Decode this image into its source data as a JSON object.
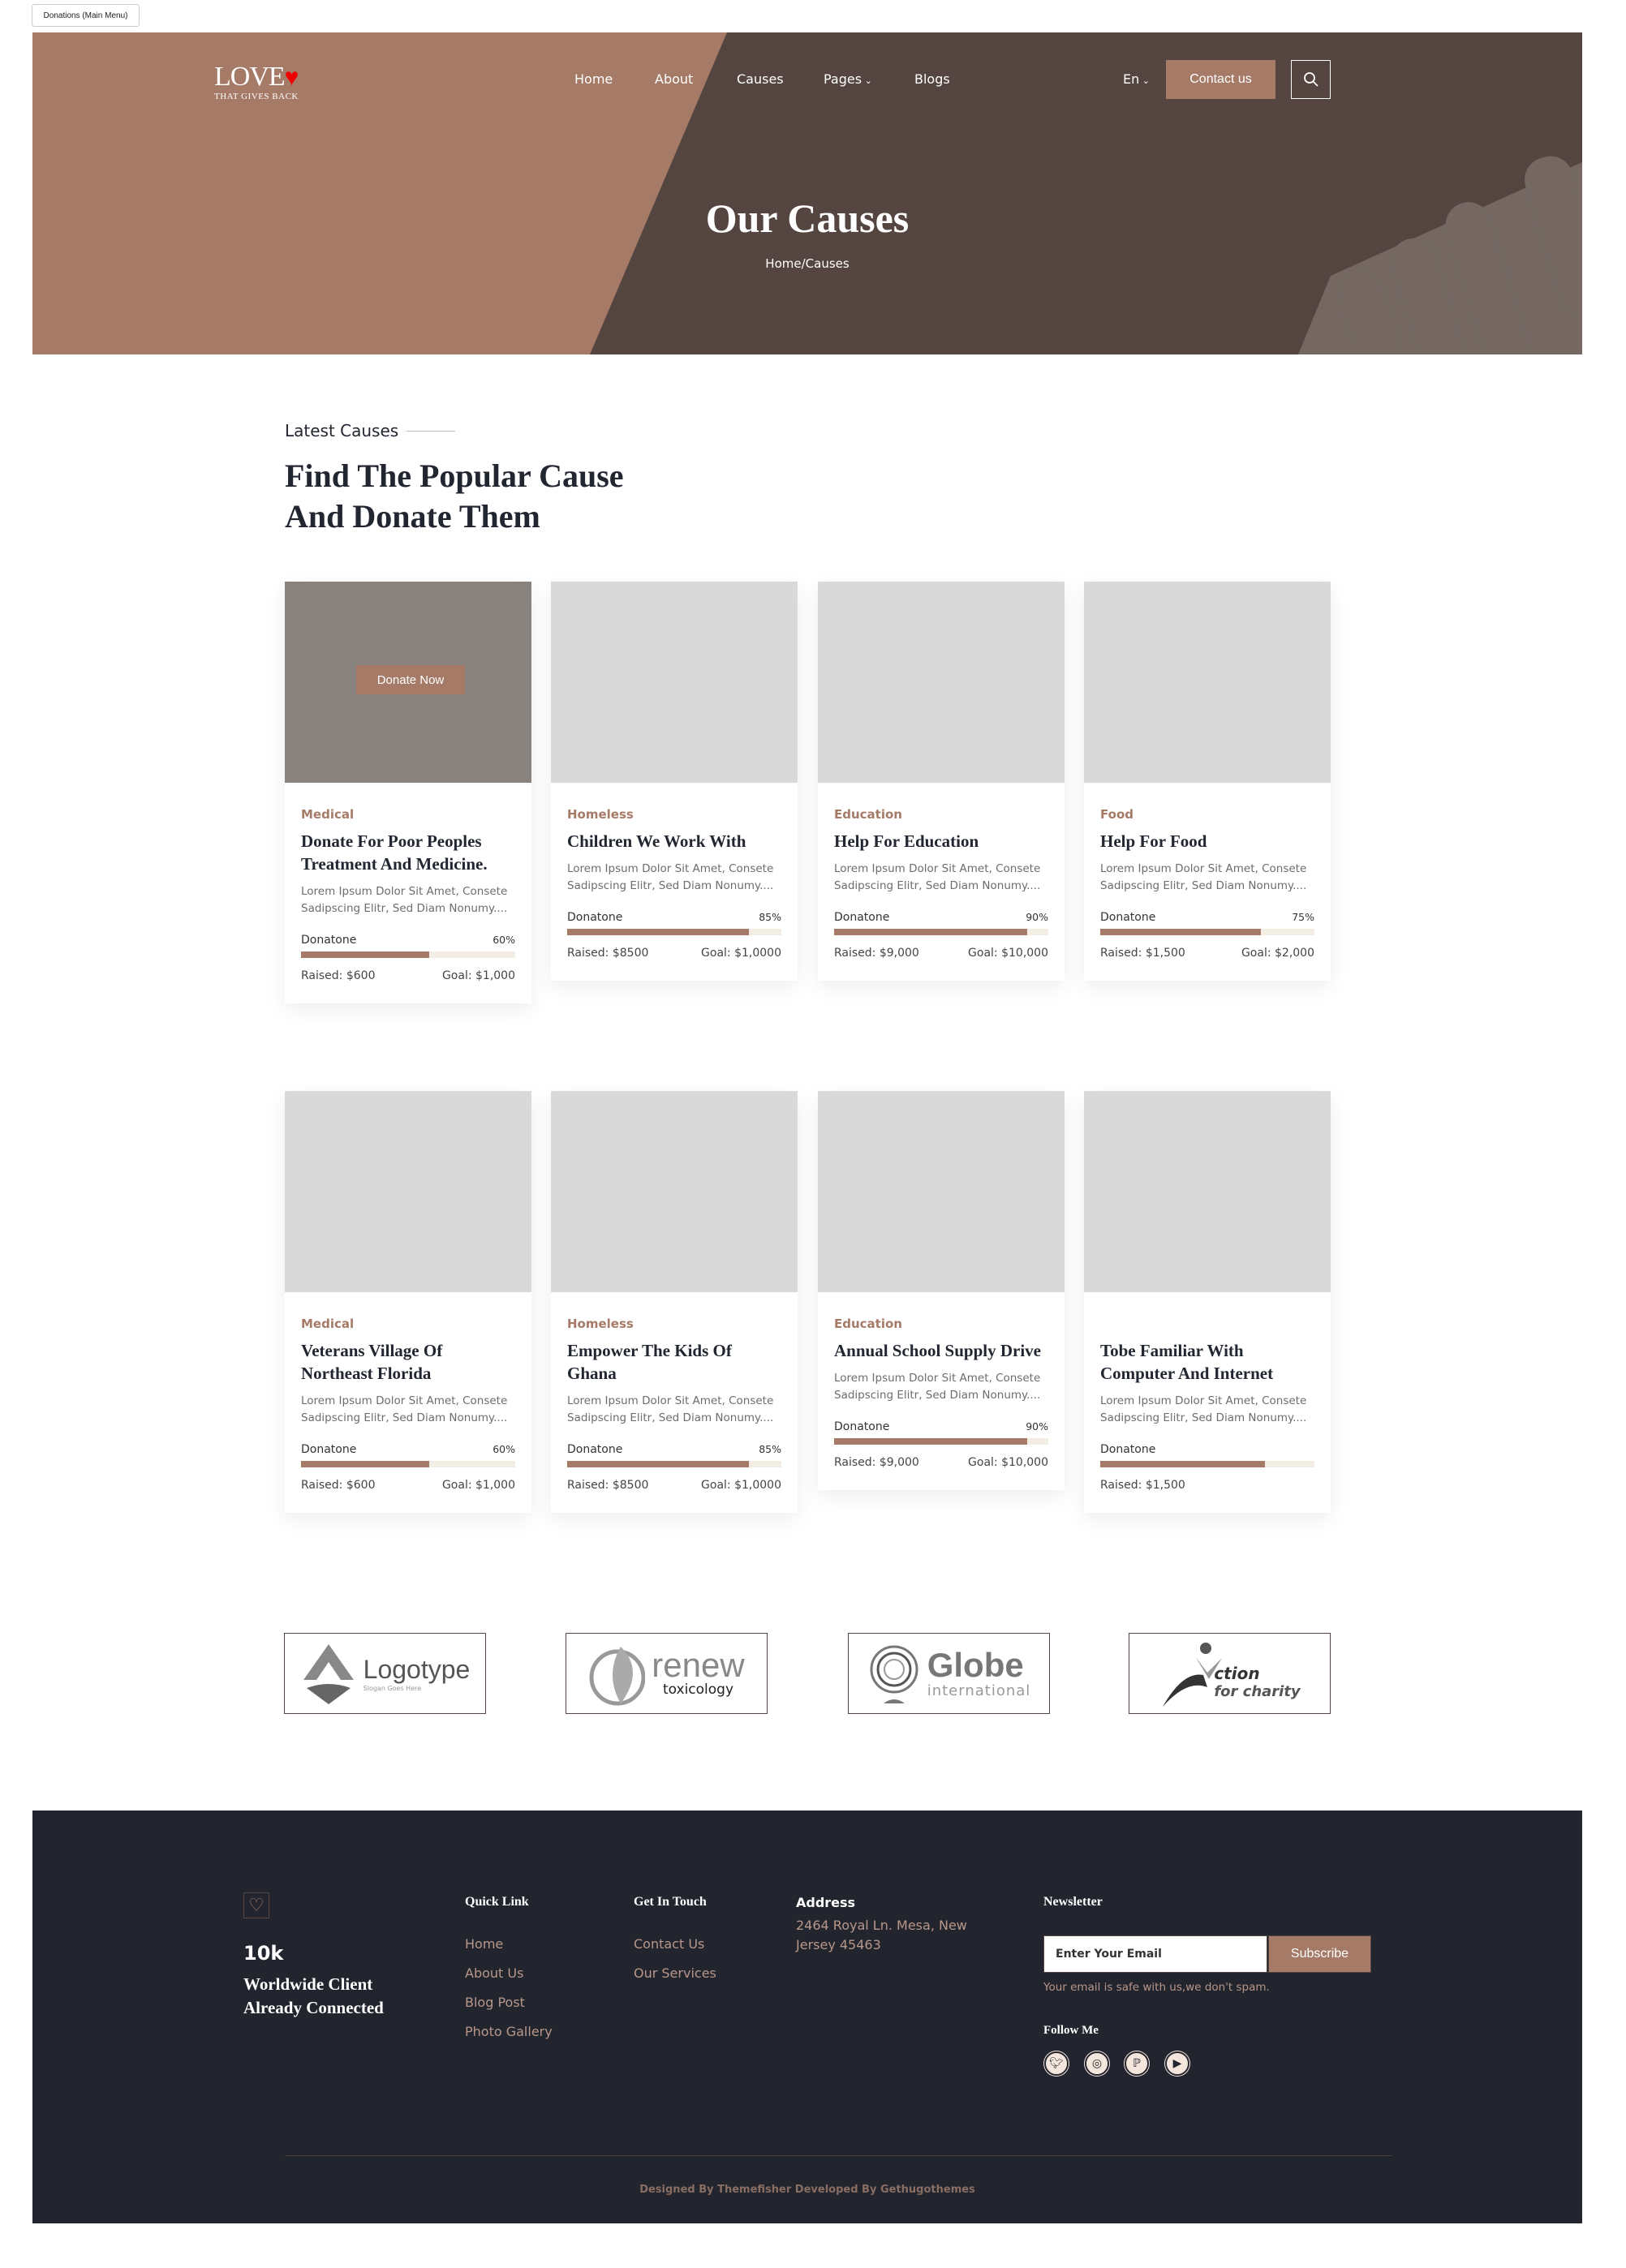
{
  "window_tag": "Donations (Main Menu)",
  "colors": {
    "brand": "#A57A67",
    "hero_dark": "#554540",
    "footer_bg": "#22252E",
    "bar_track": "#F2EEE3"
  },
  "header": {
    "logo_text": "LOVE",
    "logo_tagline": "THAT GIVES BACK",
    "nav": [
      "Home",
      "About",
      "Causes",
      "Pages",
      "Blogs"
    ],
    "language": "En",
    "contact_label": "Contact us",
    "search_icon": "search-icon"
  },
  "hero": {
    "title": "Our Causes",
    "breadcrumb": "Home/Causes"
  },
  "section": {
    "eyebrow": "Latest Causes",
    "heading_line1": "Find The Popular Cause",
    "heading_line2": "And Donate Them"
  },
  "donate_now_label": "Donate Now",
  "progress_label": "Donatone",
  "causes": [
    {
      "category": "Medical",
      "title": "Donate For Poor Peoples Treatment And Medicine.",
      "description": "Lorem Ipsum Dolor Sit Amet, Consete Sadipscing Elitr, Sed Diam Nonumy....",
      "progress": 60,
      "percent_label": "60%",
      "raised": "Raised: $600",
      "goal": "Goal: $1,000"
    },
    {
      "category": "Homeless",
      "title": "Children We Work With",
      "description": "Lorem Ipsum Dolor Sit Amet, Consete Sadipscing Elitr, Sed Diam Nonumy....",
      "progress": 85,
      "percent_label": "85%",
      "raised": "Raised: $8500",
      "goal": "Goal: $1,0000"
    },
    {
      "category": "Education",
      "title": "Help For Education",
      "description": "Lorem Ipsum Dolor Sit Amet, Consete Sadipscing Elitr, Sed Diam Nonumy....",
      "progress": 90,
      "percent_label": "90%",
      "raised": "Raised: $9,000",
      "goal": "Goal: $10,000"
    },
    {
      "category": "Food",
      "title": "Help For Food",
      "description": "Lorem Ipsum Dolor Sit Amet, Consete Sadipscing Elitr, Sed Diam Nonumy....",
      "progress": 75,
      "percent_label": "75%",
      "raised": "Raised: $1,500",
      "goal": "Goal: $2,000"
    },
    {
      "category": "Medical",
      "title": "Veterans Village Of Northeast Florida",
      "description": "Lorem Ipsum Dolor Sit Amet, Consete Sadipscing Elitr, Sed Diam Nonumy....",
      "progress": 60,
      "percent_label": "60%",
      "raised": "Raised: $600",
      "goal": "Goal: $1,000"
    },
    {
      "category": "Homeless",
      "title": "Empower The Kids Of Ghana",
      "description": "Lorem Ipsum Dolor Sit Amet, Consete Sadipscing Elitr, Sed Diam Nonumy....",
      "progress": 85,
      "percent_label": "85%",
      "raised": "Raised: $8500",
      "goal": "Goal: $1,0000"
    },
    {
      "category": "Education",
      "title": "Annual School Supply Drive",
      "description": "Lorem Ipsum Dolor Sit Amet, Consete Sadipscing Elitr, Sed Diam Nonumy....",
      "progress": 90,
      "percent_label": "90%",
      "raised": "Raised: $9,000",
      "goal": "Goal: $10,000"
    },
    {
      "category": "",
      "title": "Tobe Familiar With Computer And Internet",
      "description": "Lorem Ipsum Dolor Sit Amet, Consete Sadipscing Elitr, Sed Diam Nonumy....",
      "progress": 77,
      "raised": "Raised: $1,500"
    }
  ],
  "partners": [
    {
      "name": "Logotype",
      "sub": "Slogan Goes Here"
    },
    {
      "name": "renew",
      "sub": "toxicology"
    },
    {
      "name": "Globe",
      "sub": "international"
    },
    {
      "name": "ction",
      "sub": "for charity"
    }
  ],
  "footer": {
    "stat_value": "10k",
    "stat_line1": "Worldwide Client",
    "stat_line2": "Already Connected",
    "quick_link_title": "Quick Link",
    "quick_links": [
      "Home",
      "About Us",
      "Blog Post",
      "Photo Gallery"
    ],
    "touch_title": "Get In Touch",
    "touch_links": [
      "Contact Us",
      "Our Services"
    ],
    "address_title": "Address",
    "address_line1": "2464 Royal Ln. Mesa, New",
    "address_line2": "Jersey 45463",
    "newsletter_title": "Newsletter",
    "email_placeholder": "Enter Your Email",
    "subscribe_label": "Subscribe",
    "spam_note": "Your email is safe with us,we don't spam.",
    "follow_title": "Follow Me",
    "social_icons": [
      "twitter-icon",
      "instagram-icon",
      "pinterest-icon",
      "youtube-icon"
    ],
    "copyright": "Designed By Themefisher Developed By Gethugothemes"
  }
}
